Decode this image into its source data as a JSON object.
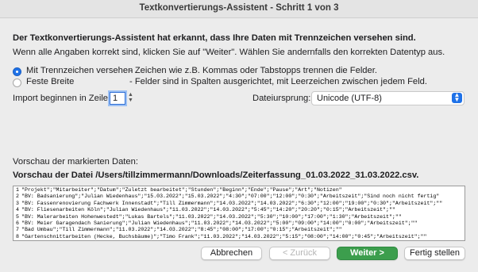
{
  "window": {
    "title": "Textkonvertierungs-Assistent - Schritt 1 von 3"
  },
  "intro": {
    "line1": "Der Textkonvertierungs-Assistent hat erkannt, dass Ihre Daten mit Trennzeichen versehen sind.",
    "line2": "Wenn alle Angaben korrekt sind, klicken Sie auf \"Weiter\". Wählen Sie andernfalls den korrekten Datentyp aus."
  },
  "datatype": {
    "options": [
      {
        "label": "Mit Trennzeichen versehen",
        "description": "- Zeichen wie z.B. Kommas oder Tabstopps trennen die Felder.",
        "selected": true
      },
      {
        "label": "Feste Breite",
        "description": "- Felder sind in Spalten ausgerichtet, mit Leerzeichen zwischen jedem Feld.",
        "selected": false
      }
    ]
  },
  "import_start": {
    "label": "Import beginnen in Zeile:",
    "value": "1"
  },
  "origin": {
    "label": "Dateiursprung:",
    "value": "Unicode (UTF-8)"
  },
  "preview": {
    "section_label": "Vorschau der markierten Daten:",
    "file_label": "Vorschau der Datei /Users/tillzimmermann/Downloads/Zeiterfassung_01.03.2022_31.03.2022.csv.",
    "rows": [
      {
        "num": "1",
        "text": "\"Projekt\";\"Mitarbeiter\";\"Datum\";\"Zuletzt bearbeitet\";\"Stunden\";\"Beginn\";\"Ende\";\"Pause\";\"Art\";\"Notizen\""
      },
      {
        "num": "2",
        "text": "\"BV: Badsanierung\";\"Julian Wiedenhaus\";\"15.03.2022\";\"15.03.2022\";\"4:30\";\"07:00\";\"12:00\";\"0:30\";\"Arbeitszeit\";\"Sind noch nicht fertig\""
      },
      {
        "num": "3",
        "text": "\"BV: Fassenrenovierung Fachwerk Innenstadt\";\"Till Zimmermann\";\"14.03.2022\";\"14.03.2022\";\"6:30\";\"12:00\";\"19:00\";\"0:30\";\"Arbeitszeit\";\"\""
      },
      {
        "num": "4",
        "text": "\"BV: Fliesenarbeiten Köln\";\"Julian Wiedenhaus\";\"11.03.2022\";\"14.03.2022\";\"5:45\";\"14:20\";\"20:20\";\"0:15\";\"Arbeitszeit\";\"\""
      },
      {
        "num": "5",
        "text": "\"BV: Malerarbeiten Hohenwestedt\";\"Lukas Bartels\";\"11.03.2022\";\"14.03.2022\";\"5:30\";\"10:00\";\"17:00\";\"1:30\";\"Arbeitszeit\";\"\""
      },
      {
        "num": "6",
        "text": "\"BV: Meier Garagendach Sanierung\";\"Julian Wiedenhaus\";\"11.03.2022\";\"14.03.2022\";\"5:00\";\"09:00\";\"14:00\";\"0:00\";\"Arbeitszeit\";\"\""
      },
      {
        "num": "7",
        "text": "\"Bad Umbau\";\"Till Zimmermann\";\"11.03.2022\";\"14.03.2022\";\"8:45\";\"08:00\";\"17:00\";\"0:15\";\"Arbeitszeit\";\"\""
      },
      {
        "num": "8",
        "text": "\"Gartenschnittarbeiten (Hecke, Buchsbäume)\";\"Timo Frank\";\"11.03.2022\";\"14.03.2022\";\"5:15\";\"08:00\";\"14:00\";\"0:45\";\"Arbeitszeit\";\"\""
      }
    ]
  },
  "buttons": {
    "cancel": "Abbrechen",
    "back": "< Zurück",
    "next": "Weiter >",
    "finish": "Fertig stellen"
  }
}
